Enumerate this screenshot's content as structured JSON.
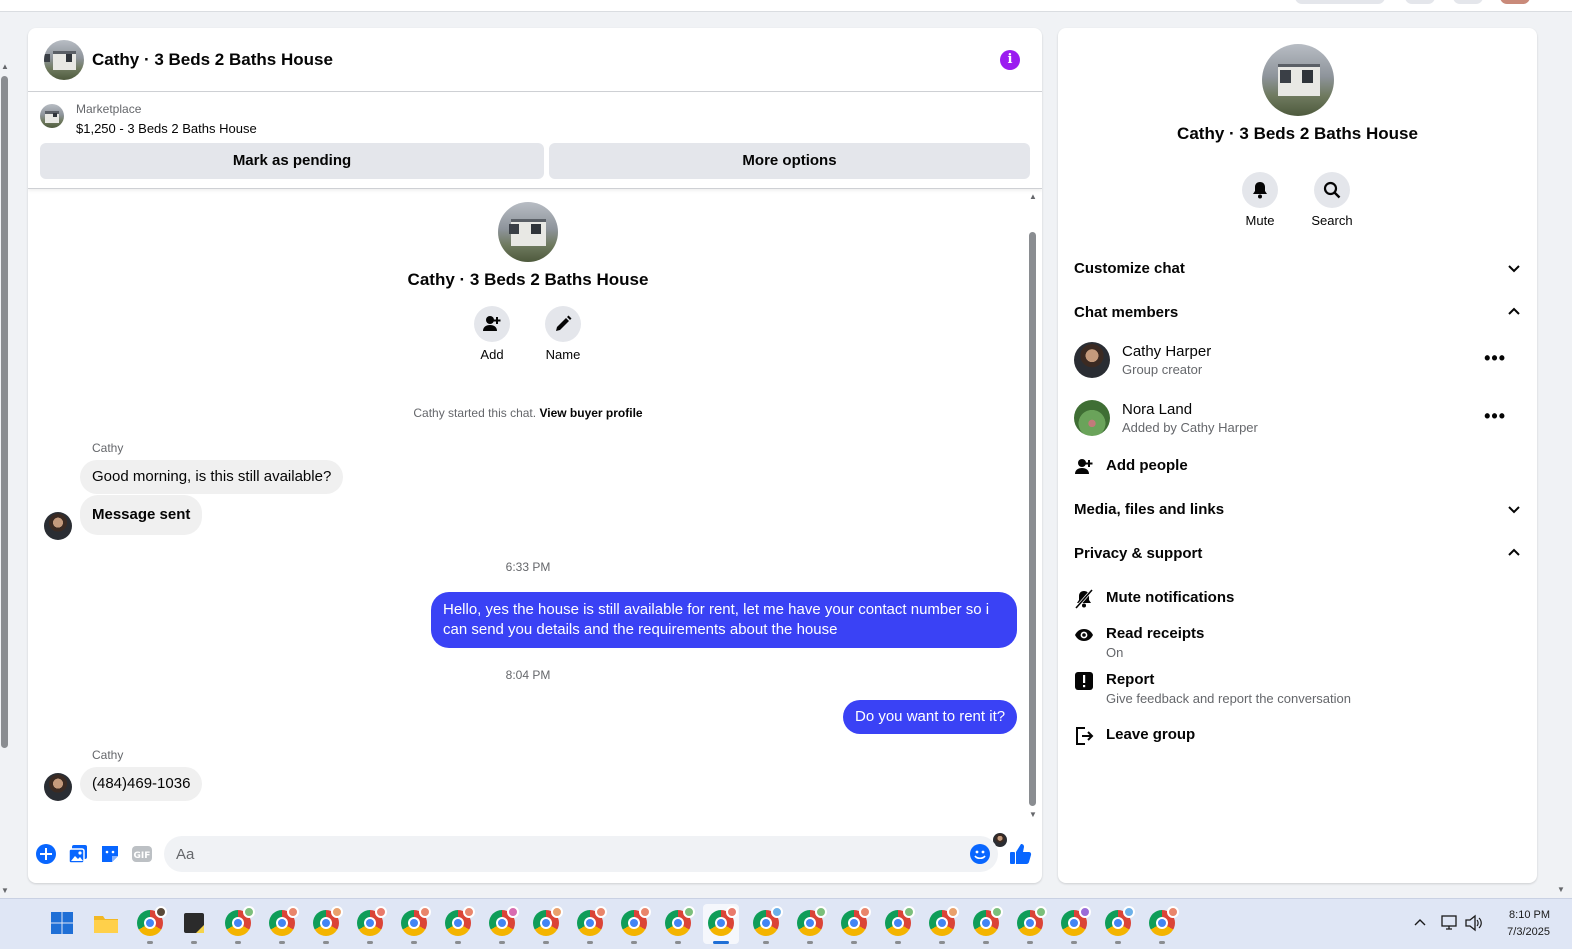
{
  "chat": {
    "title": "Cathy · 3 Beds 2 Baths House",
    "marketplace_label": "Marketplace",
    "listing": "$1,250 - 3 Beds 2 Baths House",
    "mark_pending_label": "Mark as pending",
    "more_options_label": "More options",
    "intro_title": "Cathy · 3 Beds 2 Baths House",
    "add_label": "Add",
    "name_label": "Name",
    "started_text": "Cathy started this chat.",
    "view_buyer_profile": "View buyer profile",
    "messages": [
      {
        "sender": "Cathy",
        "text": "Good morning, is this still available?"
      },
      {
        "text": "Message sent"
      },
      {
        "timestamp": "6:33 PM"
      },
      {
        "text": "Hello, yes the house is still available for rent, let me have your contact number so i can send you details and the requirements about the house"
      },
      {
        "timestamp": "8:04 PM"
      },
      {
        "text": "Do you want to rent it?"
      },
      {
        "sender": "Cathy",
        "text": "(484)469-1036"
      }
    ],
    "composer_placeholder": "Aa"
  },
  "details": {
    "title": "Cathy · 3 Beds 2 Baths House",
    "mute_label": "Mute",
    "search_label": "Search",
    "customize_chat": "Customize chat",
    "chat_members": "Chat members",
    "members": [
      {
        "name": "Cathy Harper",
        "sub": "Group creator"
      },
      {
        "name": "Nora Land",
        "sub": "Added by Cathy Harper"
      }
    ],
    "add_people": "Add people",
    "media_files_links": "Media, files and links",
    "privacy_support": "Privacy & support",
    "mute_notifications": "Mute notifications",
    "read_receipts": "Read receipts",
    "read_receipts_value": "On",
    "report": "Report",
    "report_sub": "Give feedback and report the conversation",
    "leave_group": "Leave group"
  },
  "taskbar": {
    "time": "8:10 PM",
    "date": "7/3/2025"
  },
  "colors": {
    "accent": "#3a42f5",
    "messenger_blue": "#0866ff",
    "info_purple": "#9b1bf0"
  }
}
